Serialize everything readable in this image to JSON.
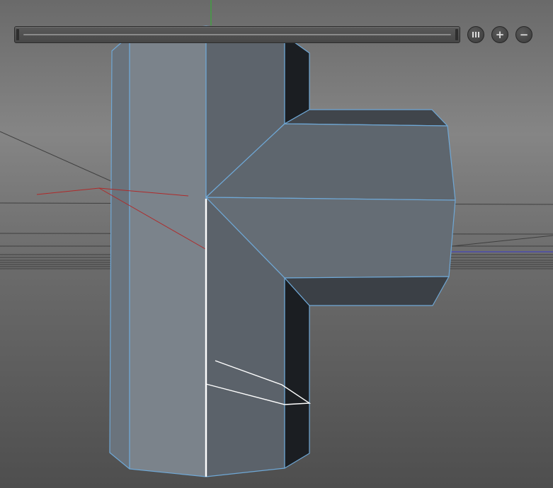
{
  "viewport": {
    "background_color": "#6e6e6e",
    "floor_color": "#5e5e5e",
    "selection_edge_color": "#6fa8d6",
    "selected_edge_color": "#ffffff",
    "axis_x_color": "#b02a2a",
    "axis_y_color": "#2db52d",
    "axis_z_color": "#3a3acb"
  },
  "timeline": {
    "icon": "timeline-scrubber"
  },
  "view_controls": {
    "buttons": [
      {
        "name": "view-mode-button",
        "icon": "grid-bars-icon"
      },
      {
        "name": "zoom-in-button",
        "icon": "plus-icon",
        "glyph": "+"
      },
      {
        "name": "zoom-out-button",
        "icon": "minus-icon",
        "glyph": "−"
      }
    ]
  },
  "model": {
    "type": "tee-pipe-mesh",
    "face_colors": {
      "left_bevel": "#6a737c",
      "front_left": "#7b838b",
      "front_right": "#5d646c",
      "dark_side": "#1b1e22",
      "branch_top": "#40454b",
      "branch_front": "#5e666e",
      "branch_bottom": "#3b4046"
    }
  }
}
